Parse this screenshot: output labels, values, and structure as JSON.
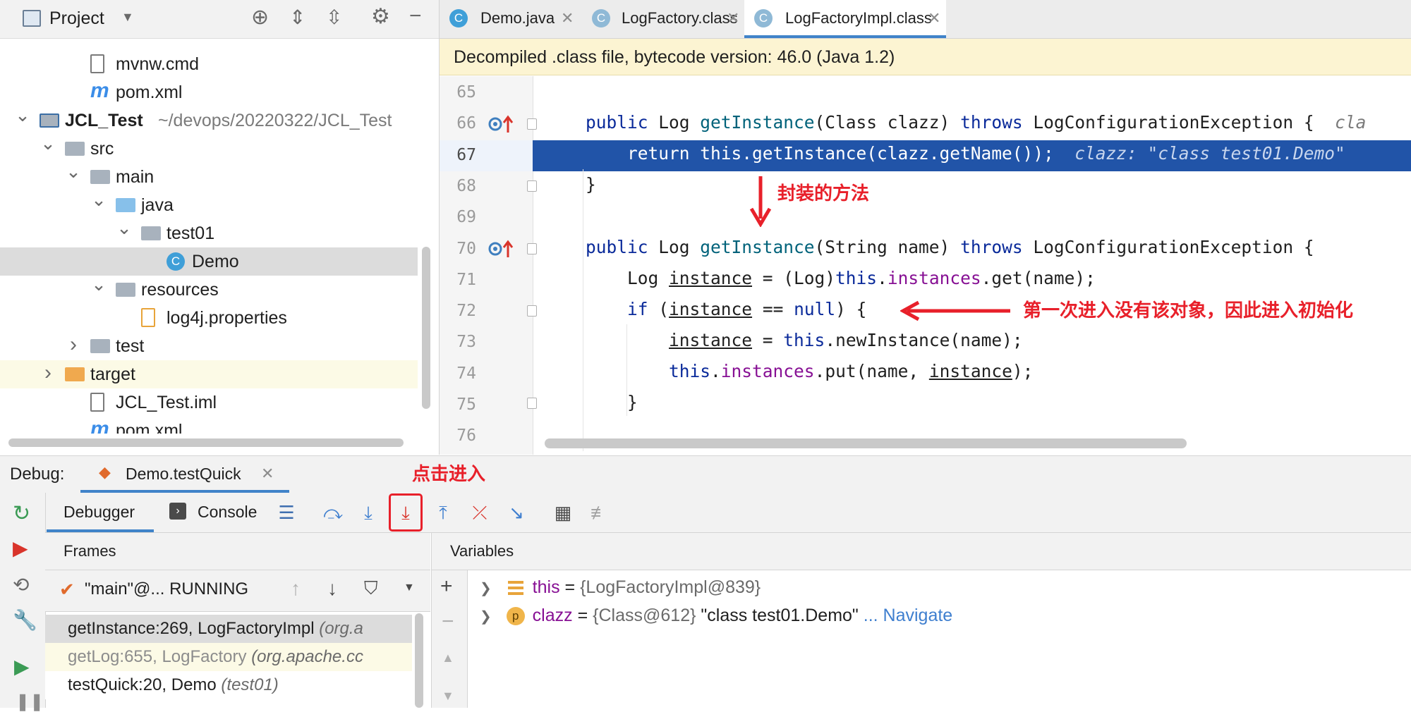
{
  "project": {
    "title": "Project",
    "tree": [
      {
        "label": "mvnw.cmd",
        "icon": "file-icon",
        "depth": 2,
        "chevron": ""
      },
      {
        "label": "pom.xml",
        "icon": "maven-icon",
        "depth": 2,
        "chevron": ""
      },
      {
        "label": "JCL_Test",
        "path": "~/devops/20220322/JCL_Test",
        "icon": "module-icon",
        "depth": 0,
        "chevron": "open"
      },
      {
        "label": "src",
        "icon": "folder-icon",
        "depth": 1,
        "chevron": "open"
      },
      {
        "label": "main",
        "icon": "folder-icon",
        "depth": 2,
        "chevron": "open"
      },
      {
        "label": "java",
        "icon": "source-folder-icon",
        "depth": 3,
        "chevron": "open"
      },
      {
        "label": "test01",
        "icon": "package-icon",
        "depth": 4,
        "chevron": "open"
      },
      {
        "label": "Demo",
        "icon": "class-icon",
        "depth": 5,
        "chevron": ""
      },
      {
        "label": "resources",
        "icon": "resources-folder-icon",
        "depth": 3,
        "chevron": "open"
      },
      {
        "label": "log4j.properties",
        "icon": "properties-icon",
        "depth": 4,
        "chevron": ""
      },
      {
        "label": "test",
        "icon": "folder-icon",
        "depth": 2,
        "chevron": "closed"
      },
      {
        "label": "target",
        "icon": "excluded-folder-icon",
        "depth": 1,
        "chevron": "closed"
      },
      {
        "label": "JCL_Test.iml",
        "icon": "iml-icon",
        "depth": 2,
        "chevron": ""
      },
      {
        "label": "pom.xml",
        "icon": "maven-icon",
        "depth": 2,
        "chevron": ""
      }
    ]
  },
  "editor": {
    "tabs": [
      {
        "label": "Demo.java",
        "active": false
      },
      {
        "label": "LogFactory.class",
        "active": false
      },
      {
        "label": "LogFactoryImpl.class",
        "active": true
      }
    ],
    "banner": "Decompiled .class file, bytecode version: 46.0 (Java 1.2)",
    "line_numbers": [
      "65",
      "66",
      "67",
      "68",
      "69",
      "70",
      "71",
      "72",
      "73",
      "74",
      "75",
      "76"
    ],
    "hint_67": "clazz: \"class test01.Demo\"",
    "hint_66": "cla",
    "annotation_1": "封装的方法",
    "annotation_2": "第一次进入没有该对象，因此进入初始化"
  },
  "debug": {
    "label": "Debug:",
    "session": "Demo.testQuick",
    "annotation": "点击进入",
    "tab_debugger": "Debugger",
    "tab_console": "Console",
    "frames_title": "Frames",
    "thread": "\"main\"@... RUNNING",
    "frames": [
      {
        "method": "getInstance:269, LogFactoryImpl",
        "pkg": "(org.a",
        "selected": true
      },
      {
        "method": "getLog:655, LogFactory",
        "pkg": "(org.apache.cc",
        "selected": false
      },
      {
        "method": "testQuick:20, Demo",
        "pkg": "(test01)",
        "selected": false
      }
    ],
    "variables_title": "Variables",
    "variables": [
      {
        "name": "this",
        "value": "{LogFactoryImpl@839}",
        "extra": "",
        "navigate": ""
      },
      {
        "name": "clazz",
        "value": "{Class@612}",
        "extra": "\"class test01.Demo\"",
        "navigate": "... Navigate"
      }
    ]
  },
  "colors": {
    "accent": "#4083c9",
    "annotation": "#e8202a",
    "exec_line": "#2154a8"
  }
}
